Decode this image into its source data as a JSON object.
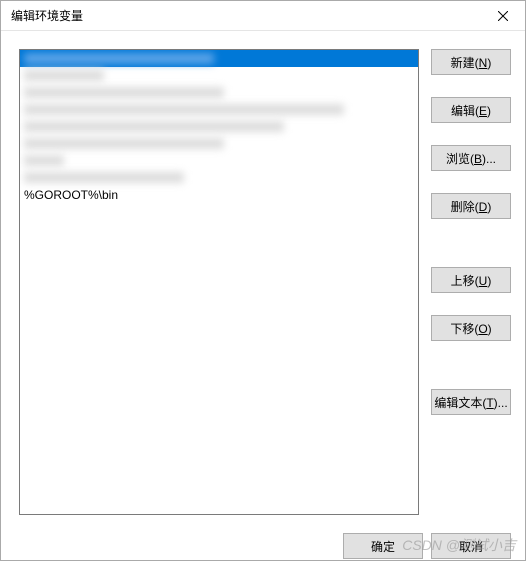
{
  "title": "编辑环境变量",
  "list": {
    "items": [
      {
        "value": "",
        "blurred": true,
        "blurWidth": 190,
        "selected": true
      },
      {
        "value": "",
        "blurred": true,
        "blurWidth": 80
      },
      {
        "value": "",
        "blurred": true,
        "blurWidth": 200
      },
      {
        "value": "",
        "blurred": true,
        "blurWidth": 320
      },
      {
        "value": "",
        "blurred": true,
        "blurWidth": 260
      },
      {
        "value": "",
        "blurred": true,
        "blurWidth": 200
      },
      {
        "value": "",
        "blurred": true,
        "blurWidth": 40
      },
      {
        "value": "",
        "blurred": true,
        "blurWidth": 160
      },
      {
        "value": "%GOROOT%\\bin",
        "blurred": false
      }
    ]
  },
  "buttons": {
    "new": "新建(N)",
    "edit": "编辑(E)",
    "browse": "浏览(B)...",
    "delete": "删除(D)",
    "moveUp": "上移(U)",
    "moveDown": "下移(O)",
    "editText": "编辑文本(T)...",
    "ok": "确定",
    "cancel": "取消"
  },
  "watermark": "CSDN @测试小吉"
}
